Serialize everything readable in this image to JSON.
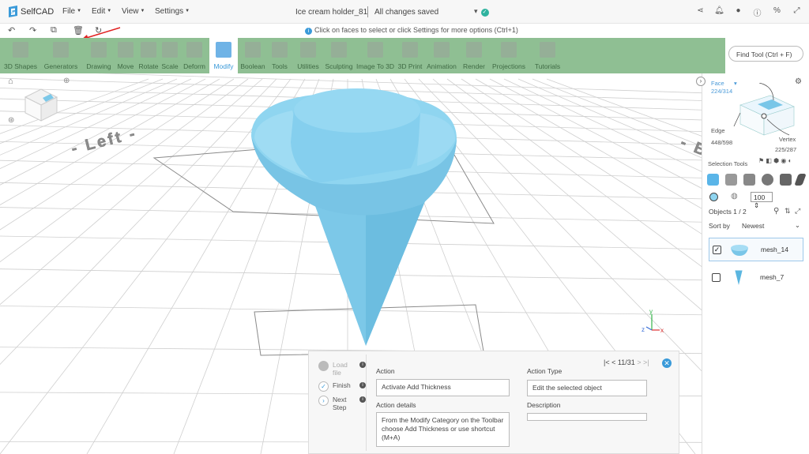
{
  "app": {
    "name": "SelfCAD",
    "project_name": "Ice cream holder_81",
    "save_status": "All changes saved"
  },
  "menu": {
    "file": "File",
    "edit": "Edit",
    "view": "View",
    "settings": "Settings"
  },
  "hint": "Click on faces to select or click Settings for more options (Ctrl+1)",
  "toolbar": {
    "items": [
      "3D Shapes",
      "Generators",
      "Drawing",
      "Move",
      "Rotate",
      "Scale",
      "Deform",
      "Modify",
      "Boolean",
      "Tools",
      "Utilities",
      "Sculpting",
      "Image To 3D",
      "3D Print",
      "Animation",
      "Render",
      "Projections",
      "Tutorials"
    ],
    "active": "Modify",
    "find_tool": "Find Tool (Ctrl + F)"
  },
  "viewport": {
    "labels": [
      "Left",
      "Back"
    ],
    "axes": [
      "z",
      "y",
      "x"
    ]
  },
  "panel": {
    "face_label": "Face",
    "face_count": "224/314",
    "edge_label": "Edge",
    "edge_count": "448/598",
    "vertex_label": "Vertex",
    "vertex_count": "225/287",
    "selection_tools": "Selection Tools",
    "size_value": "100",
    "objects": "Objects 1 / 2",
    "sort_by": "Sort by",
    "sort_value": "Newest",
    "objects_list": [
      {
        "name": "mesh_14",
        "checked": true
      },
      {
        "name": "mesh_7",
        "checked": false
      }
    ]
  },
  "tutorial": {
    "steps": [
      "Load file",
      "Finish",
      "Next Step"
    ],
    "action_label": "Action",
    "action_value": "Activate Add Thickness",
    "details_label": "Action details",
    "details_value": "From the Modify Category on the Toolbar choose Add Thickness or use shortcut (M+A)",
    "type_label": "Action Type",
    "type_value": "Edit the selected object",
    "description_label": "Description",
    "description_value": "",
    "pager": "11/31"
  },
  "colors": {
    "toolbar": "#8fbf93",
    "accent": "#3a9ad9",
    "mesh": "#86d0ee"
  }
}
